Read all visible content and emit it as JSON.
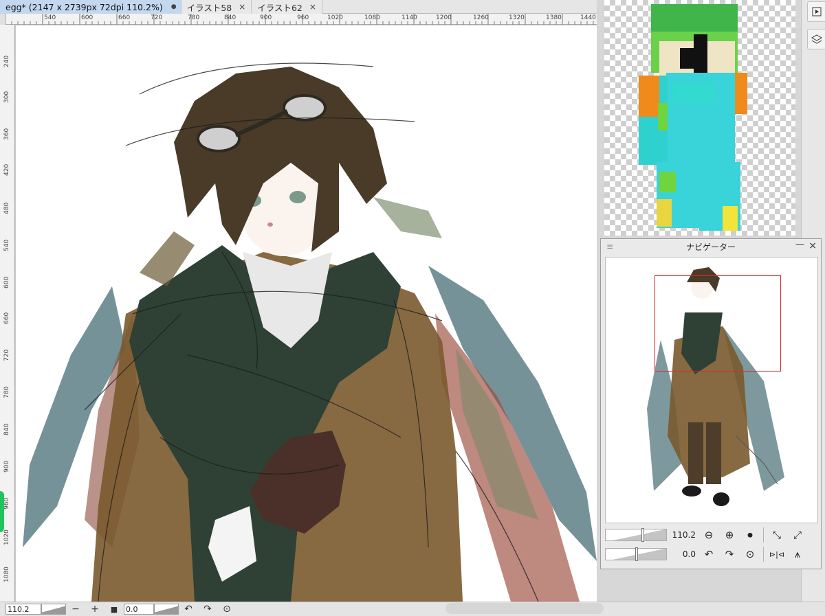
{
  "tabs": [
    {
      "label": "egg* (2147 x 2739px 72dpi 110.2%)",
      "indicator": "●",
      "active": true
    },
    {
      "label": "イラスト58",
      "close": "×",
      "active": false
    },
    {
      "label": "イラスト62",
      "close": "×",
      "active": false
    }
  ],
  "ruler_top": [
    "540",
    "600",
    "660",
    "720",
    "780",
    "840",
    "900",
    "960",
    "1020",
    "1080",
    "1140",
    "1200",
    "1260",
    "1320",
    "1380",
    "1440"
  ],
  "ruler_left": [
    "240",
    "300",
    "360",
    "420",
    "480",
    "540",
    "600",
    "660",
    "720",
    "780",
    "840",
    "900",
    "960",
    "1020",
    "1080"
  ],
  "statusbar": {
    "zoom": "110.2",
    "zoom_out": "−",
    "zoom_in": "+",
    "fit": "■",
    "rotation": "0.0",
    "rotate_left": "↶",
    "rotate_right": "↷",
    "reset_rotation": "⊙"
  },
  "navigator": {
    "title": "ナビゲーター",
    "grip": "≡",
    "minimize": "—",
    "close": "×",
    "zoom_value": "110.2",
    "zoom_level": 0.6,
    "rotation_value": "0.0",
    "rotation_level": 0.5,
    "buttons_row1": [
      "⊖",
      "⊕",
      "⏺",
      "⤡",
      "⤢"
    ],
    "buttons_row2": [
      "↶",
      "↷",
      "⊙",
      "⊳|⊲",
      "⩚"
    ]
  },
  "colors": {
    "accent_tab": "#c3d7ef",
    "viewport_frame": "#e0282a",
    "green_marker": "#21c45a"
  }
}
